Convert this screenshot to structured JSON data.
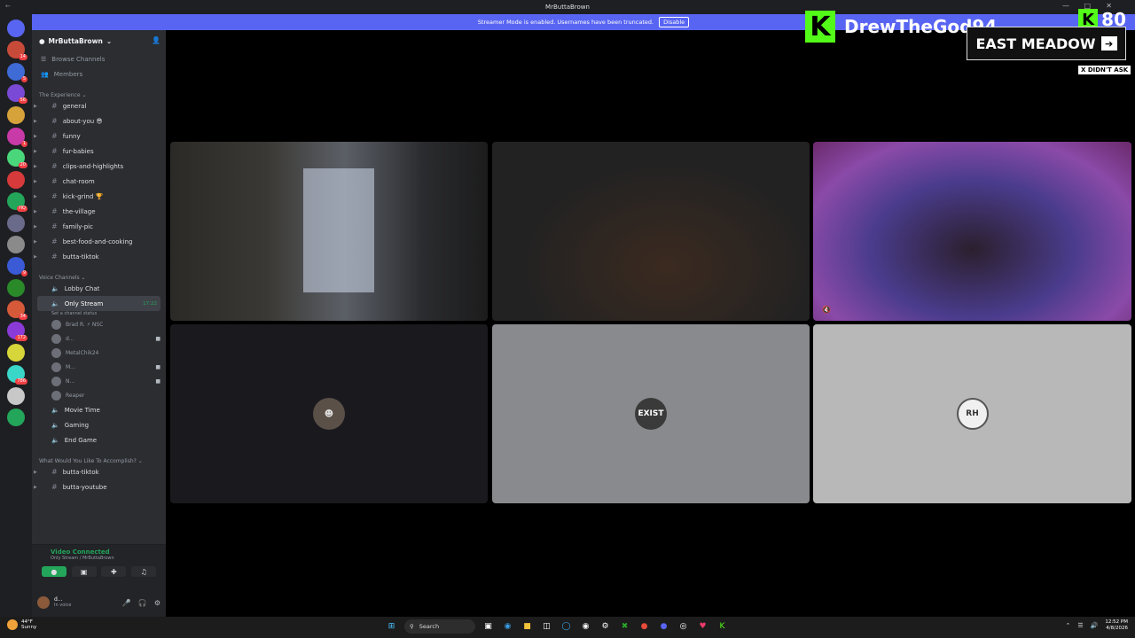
{
  "window": {
    "title": "MrButtaBrown"
  },
  "banner": {
    "text": "Streamer Mode is enabled. Usernames have been truncated.",
    "button": "Disable"
  },
  "servers": [
    {
      "color": "#c84b3a",
      "badge": "14"
    },
    {
      "color": "#3f6bd6",
      "badge": "5"
    },
    {
      "color": "#7a4ad6",
      "badge": "56"
    },
    {
      "color": "#d6a23a",
      "badge": ""
    },
    {
      "color": "#c83aa8",
      "badge": "1"
    },
    {
      "color": "#4ad67a",
      "badge": "20"
    },
    {
      "color": "#d63a3a",
      "badge": ""
    },
    {
      "color": "#23a55a",
      "badge": "HQ"
    },
    {
      "color": "#6a6a8a",
      "badge": ""
    },
    {
      "color": "#8a8a8a",
      "badge": ""
    },
    {
      "color": "#3a5ad6",
      "badge": "9"
    },
    {
      "color": "#2a8a2a",
      "badge": ""
    },
    {
      "color": "#d65a3a",
      "badge": "34"
    },
    {
      "color": "#8a3ad6",
      "badge": "172"
    },
    {
      "color": "#d6d63a",
      "badge": ""
    },
    {
      "color": "#3ad6c8",
      "badge": "786"
    },
    {
      "color": "#c8c8c8",
      "badge": ""
    },
    {
      "color": "#23a55a",
      "badge": ""
    }
  ],
  "sidebar": {
    "guild": "MrButtaBrown",
    "nav": [
      "Browse Channels",
      "Members"
    ],
    "categories": [
      {
        "name": "The Experience",
        "channels": [
          "general",
          "about-you 😎",
          "funny",
          "fur-babies",
          "clips-and-highlights",
          "chat-room",
          "kick-grind 🏆",
          "the-village",
          "family-pic",
          "best-food-and-cooking",
          "butta-tiktok"
        ]
      },
      {
        "name": "Voice Channels"
      },
      {
        "name": "What Would You Like To Accomplish?",
        "channels": [
          "butta-tiktok",
          "butta-youtube"
        ]
      }
    ],
    "voice": {
      "lobby": "Lobby Chat",
      "active": "Only Stream",
      "active_time": "17:22",
      "status": "Set a channel status",
      "users": [
        "Brad R. ⚡ NSC",
        "d...",
        "MetalChik24",
        "M...",
        "N...",
        "Reaper"
      ],
      "more": [
        "Movie Time",
        "Gaming",
        "End Game"
      ]
    }
  },
  "rtc": {
    "title": "Video Connected",
    "sub": "Only Stream / MrButtaBrown"
  },
  "user": {
    "name": "d...",
    "status": "In voice"
  },
  "tiles": {
    "t5_avatar": "EXIST",
    "t6_avatar": "RH"
  },
  "overlay": {
    "kick_name": "DrewTheGod94",
    "kick_count": "80",
    "meadow": "EAST MEADOW",
    "didnt_ask": "X DIDN'T ASK"
  },
  "taskbar": {
    "weather_temp": "44°F",
    "weather_desc": "Sunny",
    "search": "Search",
    "time": "12:52 PM",
    "date": "4/8/2026"
  }
}
